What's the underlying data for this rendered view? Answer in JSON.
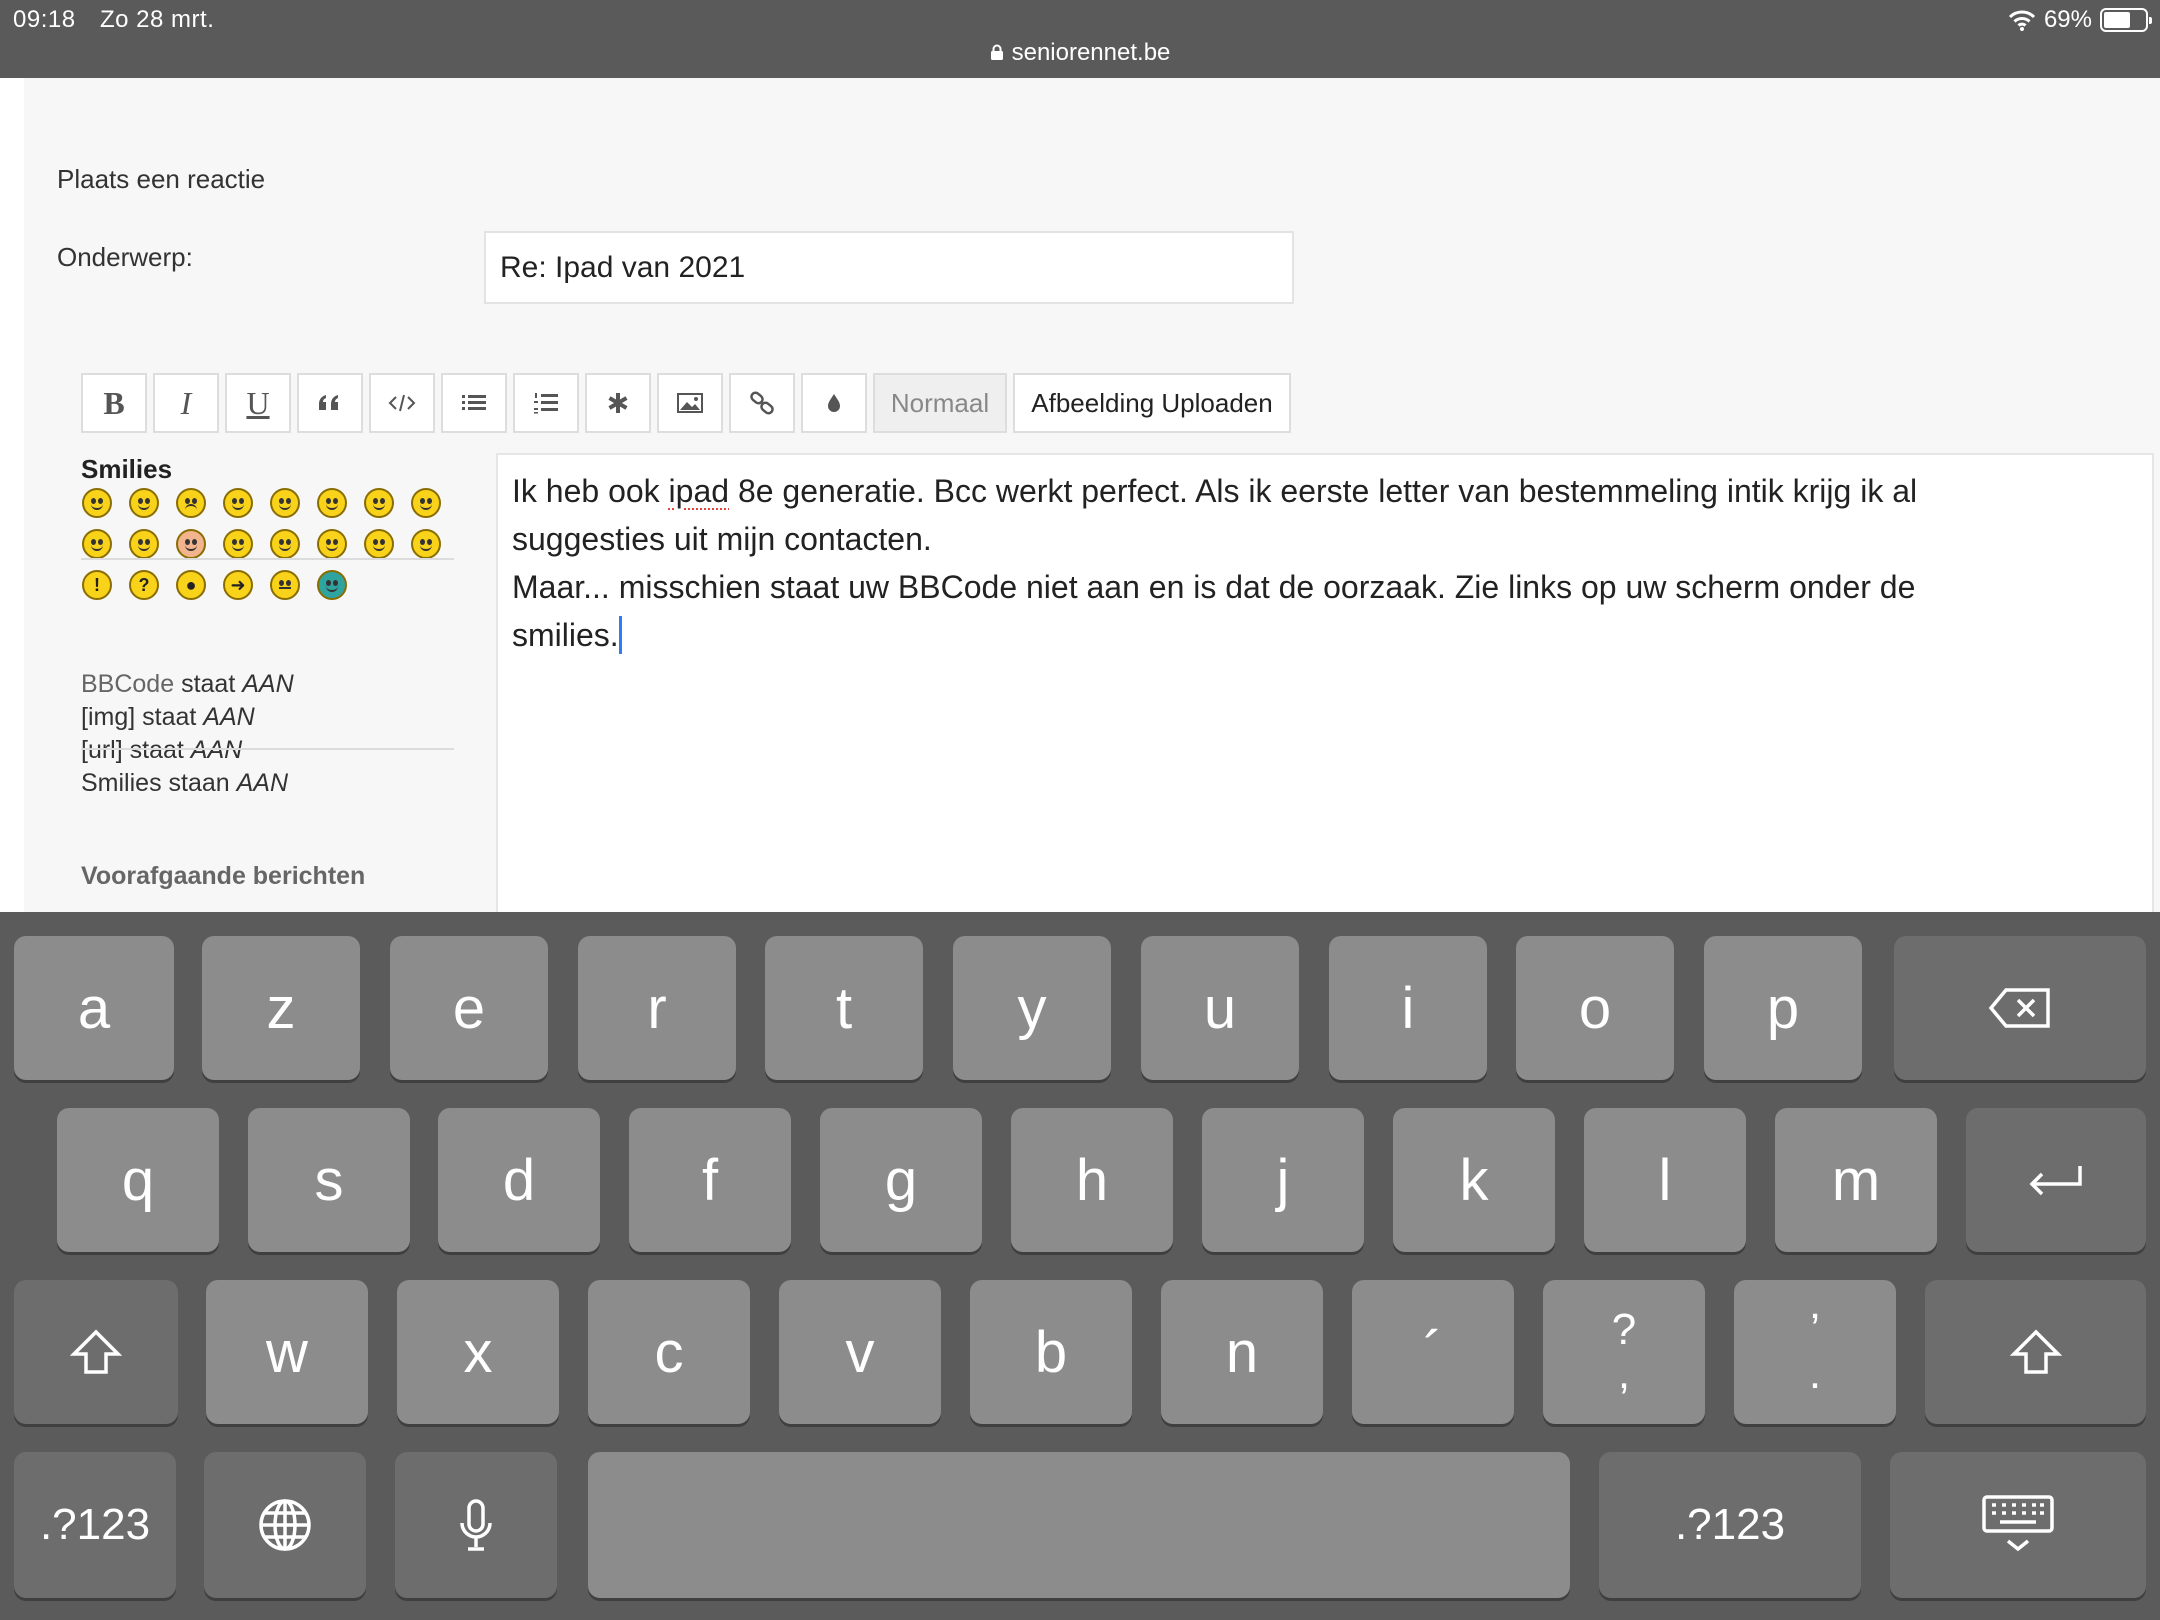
{
  "status_bar": {
    "time": "09:18",
    "date": "Zo 28 mrt.",
    "url": "seniorennet.be",
    "battery": "69%",
    "battery_level": 0.69
  },
  "form": {
    "heading": "Plaats een reactie",
    "subject_label": "Onderwerp:",
    "subject_value": "Re: Ipad  van 2021"
  },
  "toolbar": {
    "buttons": [
      {
        "name": "bold",
        "label": "B"
      },
      {
        "name": "italic",
        "label": "I"
      },
      {
        "name": "underline",
        "label": "U"
      },
      {
        "name": "quote",
        "icon": "quote-icon"
      },
      {
        "name": "code",
        "icon": "code-icon"
      },
      {
        "name": "bullet-list",
        "icon": "bullet-list-icon"
      },
      {
        "name": "numbered-list",
        "icon": "numbered-list-icon"
      },
      {
        "name": "list-item",
        "icon": "asterisk-icon"
      },
      {
        "name": "image",
        "icon": "image-icon"
      },
      {
        "name": "link",
        "icon": "link-icon"
      },
      {
        "name": "color",
        "icon": "droplet-icon"
      }
    ],
    "size_select": "Normaal",
    "upload_label": "Afbeelding Uploaden"
  },
  "sidebar": {
    "smilies_title": "Smilies",
    "bbcode": {
      "link": "BBCode",
      "text": " staat ",
      "state": "AAN"
    },
    "img": {
      "text": "[img] staat ",
      "state": "AAN"
    },
    "url": {
      "text": "[url] staat ",
      "state": "AAN"
    },
    "smilies": {
      "text": "Smilies staan ",
      "state": "AAN"
    },
    "previous_messages": "Voorafgaande berichten"
  },
  "message": {
    "line1_before": "Ik heb ook ",
    "line1_misspelled": "ipad",
    "line1_after": " 8e generatie. Bcc werkt perfect. Als ik eerste letter van bestemmeling intik krijg ik al",
    "line2": "suggesties uit mijn contacten.",
    "line3": "Maar... misschien staat uw BBCode niet aan en is dat de oorzaak. Zie links op uw scherm onder de",
    "line4": "smilies."
  },
  "keyboard": {
    "row1": [
      "a",
      "z",
      "e",
      "r",
      "t",
      "y",
      "u",
      "i",
      "o",
      "p"
    ],
    "row2": [
      "q",
      "s",
      "d",
      "f",
      "g",
      "h",
      "j",
      "k",
      "l",
      "m"
    ],
    "row3": [
      "w",
      "x",
      "c",
      "v",
      "b",
      "n",
      "´"
    ],
    "row3_punct1_top": "?",
    "row3_punct1_bottom": ",",
    "row3_punct2_top": "’",
    "row3_punct2_bottom": ".",
    "numbers_label": ".?123"
  }
}
